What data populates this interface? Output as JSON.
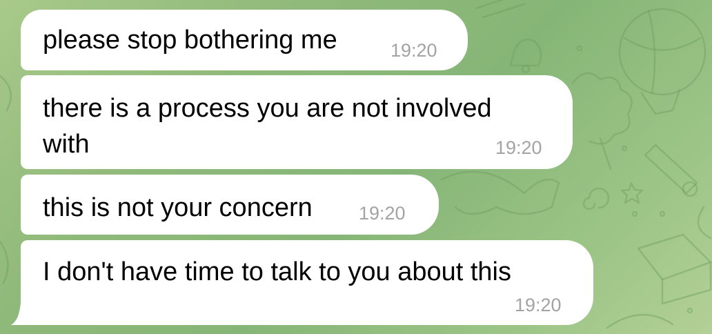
{
  "messages": [
    {
      "text": "please stop bothering me",
      "time": "19:20"
    },
    {
      "lines": [
        "there is a process you are not involved",
        "with"
      ],
      "time": "19:20"
    },
    {
      "text": "this is not your concern",
      "time": "19:20"
    },
    {
      "text": "I don't have time to talk to you about this",
      "time": "19:20"
    }
  ],
  "colors": {
    "bubble_background": "#ffffff",
    "message_text": "#000000",
    "timestamp_text": "#a3a3a3",
    "wallpaper": "#8fb97a"
  },
  "icons": [
    "chat-wallpaper-doodle-pattern"
  ]
}
